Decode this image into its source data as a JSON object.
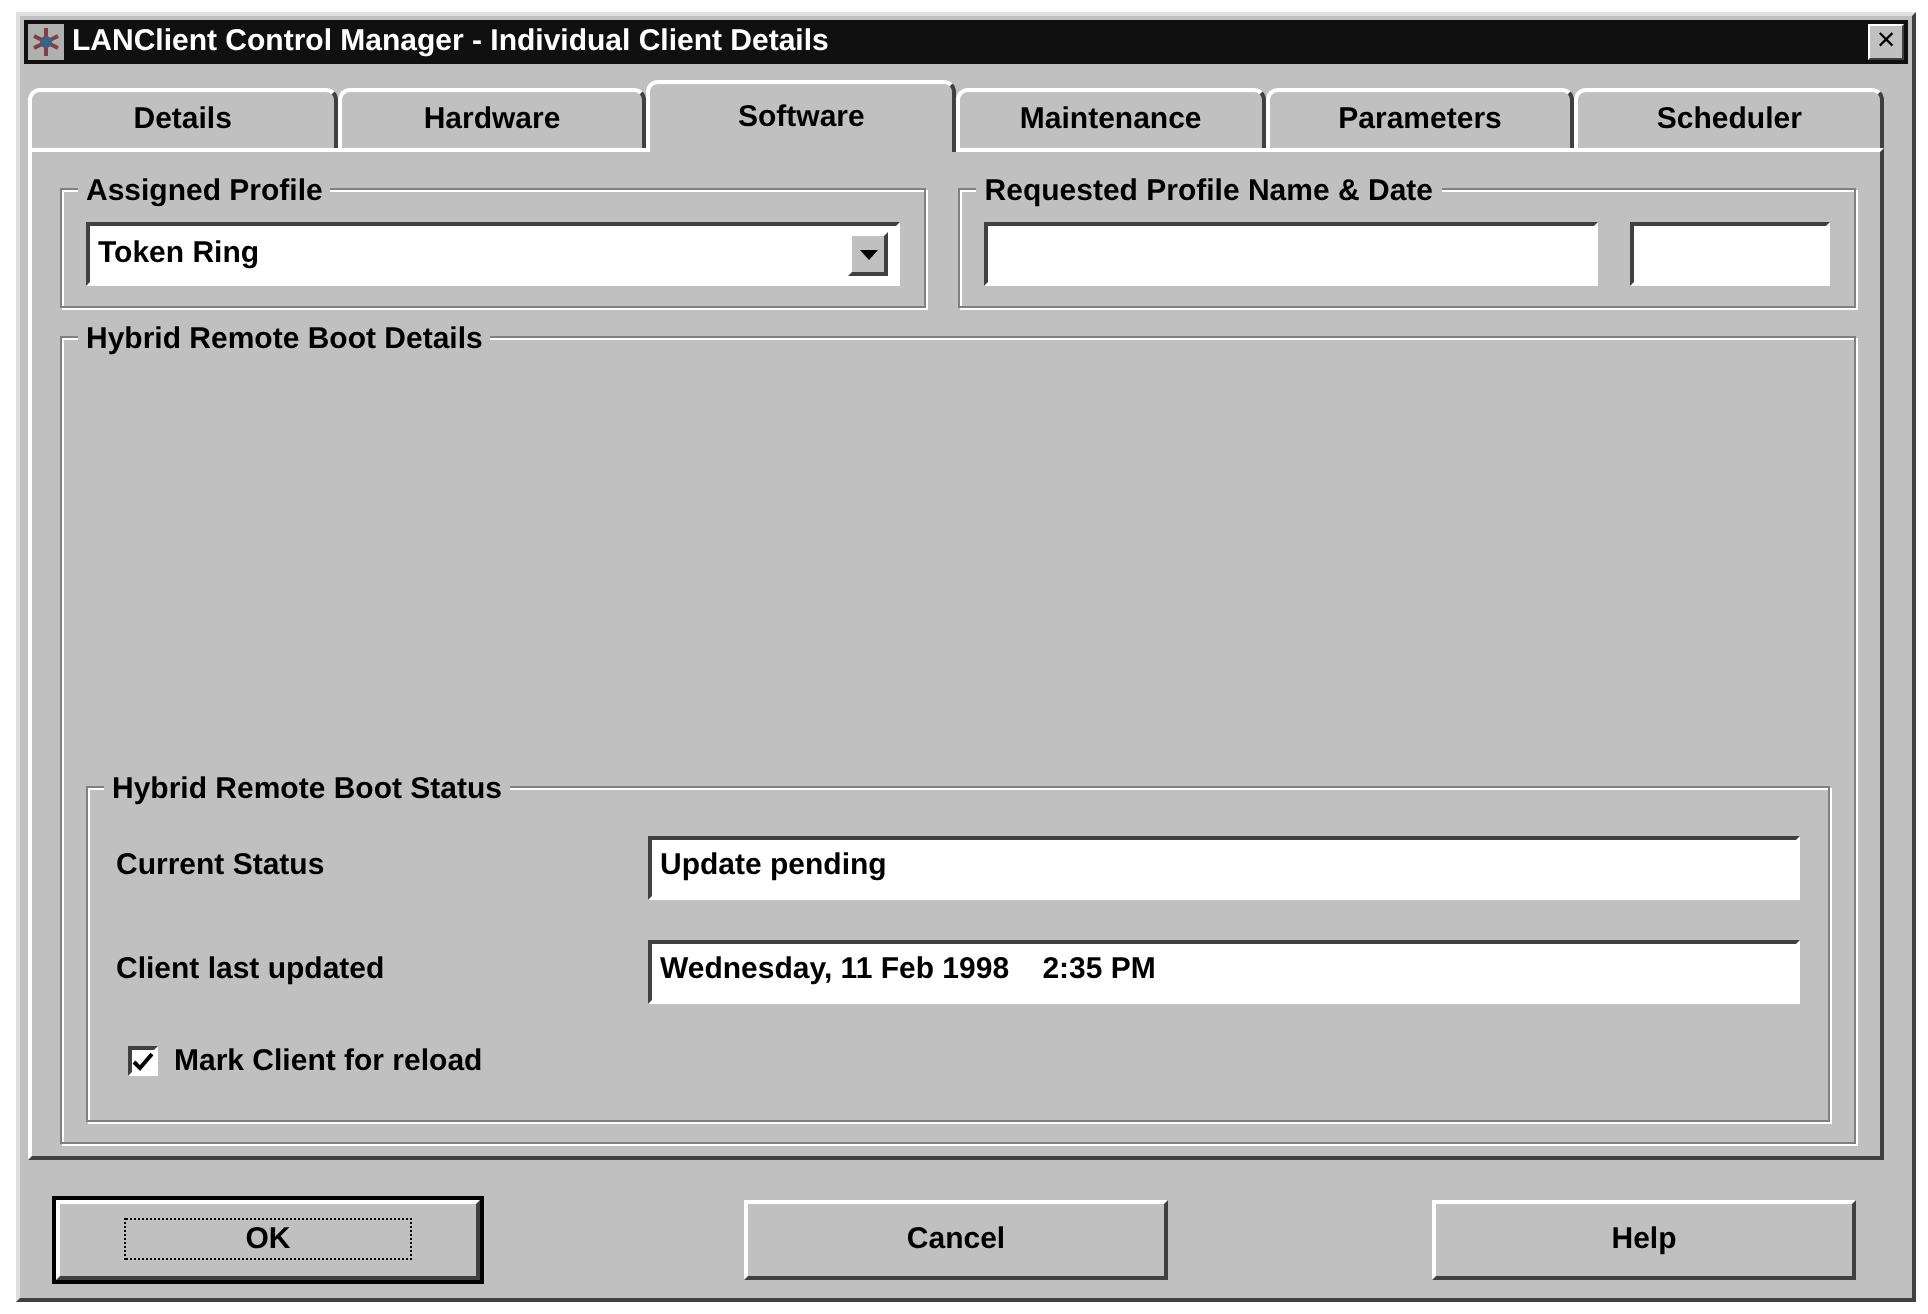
{
  "window": {
    "title": "LANClient Control Manager - Individual Client Details",
    "close": "×"
  },
  "tabs": [
    {
      "label": "Details",
      "selected": false
    },
    {
      "label": "Hardware",
      "selected": false
    },
    {
      "label": "Software",
      "selected": true
    },
    {
      "label": "Maintenance",
      "selected": false
    },
    {
      "label": "Parameters",
      "selected": false
    },
    {
      "label": "Scheduler",
      "selected": false
    }
  ],
  "assigned_profile": {
    "title": "Assigned Profile",
    "value": "Token Ring"
  },
  "requested_profile": {
    "title": "Requested Profile Name & Date"
  },
  "details": {
    "title": "Hybrid Remote Boot Details",
    "status": {
      "title": "Hybrid Remote Boot Status",
      "fields": [
        {
          "label": "Current Status",
          "value": "Update pending"
        },
        {
          "label": "Client last updated",
          "value": "Wednesday, 11 Feb 1998    2:35 PM"
        }
      ],
      "checkbox": {
        "label": "Mark Client for reload",
        "checked": true
      }
    }
  },
  "buttons": [
    {
      "label": "OK",
      "default": true
    },
    {
      "label": "Cancel",
      "default": false
    },
    {
      "label": "Help",
      "default": false
    }
  ]
}
